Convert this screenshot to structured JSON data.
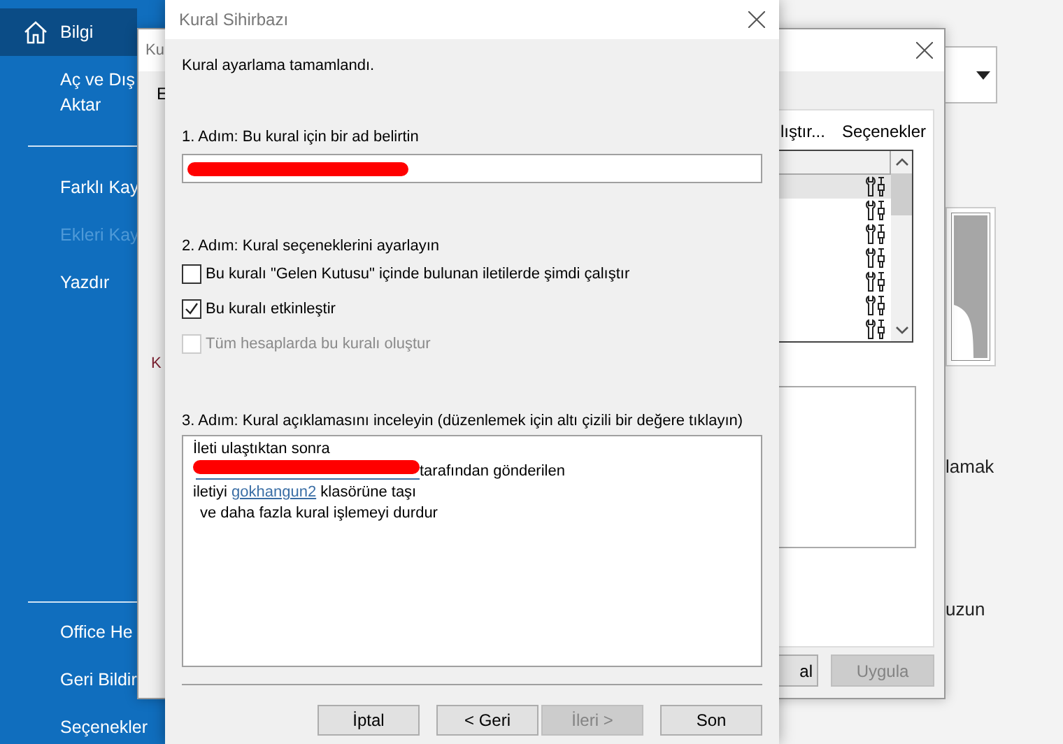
{
  "backstage": {
    "nav_top": [
      {
        "lines": [
          "Bilgi"
        ],
        "selected": true,
        "disabled": false
      },
      {
        "lines": [
          "Aç ve Dış",
          "Aktar"
        ],
        "selected": false,
        "disabled": false
      },
      {
        "kind": "divider"
      },
      {
        "lines": [
          "Farklı Kay"
        ],
        "selected": false,
        "disabled": false
      },
      {
        "lines": [
          "Ekleri Kay"
        ],
        "selected": false,
        "disabled": true
      },
      {
        "lines": [
          "Yazdır"
        ],
        "selected": false,
        "disabled": false
      }
    ],
    "nav_bottom": [
      {
        "lines": [
          "Office He"
        ],
        "selected": false,
        "disabled": false
      },
      {
        "lines": [
          "Geri Bildir"
        ],
        "selected": false,
        "disabled": false
      },
      {
        "lines": [
          "Seçenekler"
        ],
        "selected": false,
        "disabled": false
      }
    ],
    "main": {
      "texts": [
        "lamak",
        "uzun"
      ]
    }
  },
  "rules_dialog": {
    "title": "Ku",
    "tab_fragment": "E",
    "section_fragment": "K",
    "actions": [
      "lıştır...",
      "Seçenekler"
    ],
    "rules": [
      {
        "selected": true
      },
      {
        "selected": false
      },
      {
        "selected": false
      },
      {
        "selected": false
      },
      {
        "selected": false
      },
      {
        "selected": false
      },
      {
        "selected": false
      }
    ],
    "buttons": [
      {
        "label": "al",
        "disabled": false
      },
      {
        "label": "Uygula",
        "disabled": true
      }
    ]
  },
  "wizard": {
    "title": "Kural Sihirbazı",
    "intro": "Kural ayarlama tamamlandı.",
    "step1": {
      "label": "1. Adım: Bu kural için bir ad belirtin",
      "name_redacted": true
    },
    "step2": {
      "label": "2. Adım: Kural seçeneklerini ayarlayın",
      "options": [
        {
          "label": "Bu kuralı \"Gelen Kutusu\" içinde bulunan iletilerde şimdi çalıştır",
          "checked": false,
          "disabled": false
        },
        {
          "label": "Bu kuralı etkinleştir",
          "checked": true,
          "disabled": false
        },
        {
          "label": "Tüm hesaplarda bu kuralı oluştur",
          "checked": false,
          "disabled": true
        }
      ]
    },
    "step3": {
      "label": "3. Adım: Kural açıklamasını inceleyin (düzenlemek için altı çizili bir değere tıklayın)",
      "lines": [
        {
          "indent": false,
          "parts": [
            {
              "kind": "text",
              "text": "İleti ulaştıktan sonra"
            }
          ]
        },
        {
          "indent": false,
          "parts": [
            {
              "kind": "redacted"
            },
            {
              "kind": "text",
              "text": "tarafından gönderilen"
            }
          ]
        },
        {
          "indent": false,
          "parts": [
            {
              "kind": "text",
              "text": "iletiyi "
            },
            {
              "kind": "link",
              "text": "gokhangun2"
            },
            {
              "kind": "text",
              "text": " klasörüne taşı"
            }
          ]
        },
        {
          "indent": true,
          "parts": [
            {
              "kind": "text",
              "text": "ve daha fazla kural işlemeyi durdur"
            }
          ]
        }
      ]
    },
    "buttons": [
      {
        "label": "İptal",
        "disabled": false
      },
      {
        "label": "< Geri",
        "disabled": false
      },
      {
        "label": "İleri >",
        "disabled": true
      },
      {
        "label": "Son",
        "disabled": false
      }
    ]
  }
}
